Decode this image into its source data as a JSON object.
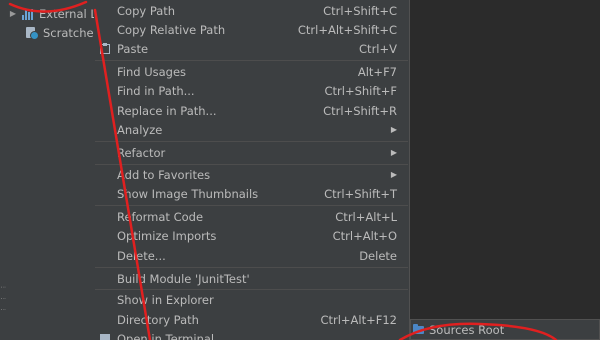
{
  "project_tree": {
    "items": [
      {
        "label": "External L",
        "icon": "library-bars-icon"
      },
      {
        "label": "Scratches",
        "icon": "scratches-icon"
      }
    ]
  },
  "context_menu": {
    "items": [
      {
        "label": "Copy Path",
        "shortcut": "Ctrl+Shift+C"
      },
      {
        "label": "Copy Relative Path",
        "shortcut": "Ctrl+Alt+Shift+C"
      },
      {
        "label": "Paste",
        "shortcut": "Ctrl+V",
        "icon": "paste-icon"
      },
      {
        "label": "Find Usages",
        "shortcut": "Alt+F7"
      },
      {
        "label": "Find in Path...",
        "shortcut": "Ctrl+Shift+F"
      },
      {
        "label": "Replace in Path...",
        "shortcut": "Ctrl+Shift+R"
      },
      {
        "label": "Analyze",
        "shortcut": "",
        "submenu": true
      },
      {
        "label": "Refactor",
        "shortcut": "",
        "submenu": true
      },
      {
        "label": "Add to Favorites",
        "shortcut": "",
        "submenu": true
      },
      {
        "label": "Show Image Thumbnails",
        "shortcut": "Ctrl+Shift+T"
      },
      {
        "label": "Reformat Code",
        "shortcut": "Ctrl+Alt+L"
      },
      {
        "label": "Optimize Imports",
        "shortcut": "Ctrl+Alt+O"
      },
      {
        "label": "Delete...",
        "shortcut": "Delete"
      },
      {
        "label": "Build Module 'JunitTest'",
        "shortcut": ""
      },
      {
        "label": "Show in Explorer",
        "shortcut": ""
      },
      {
        "label": "Directory Path",
        "shortcut": "Ctrl+Alt+F12"
      },
      {
        "label": "Open in Terminal",
        "shortcut": "",
        "icon": "terminal-icon"
      }
    ],
    "submenu_glyph": "▶"
  },
  "submenu": {
    "items": [
      {
        "label": "Sources Root",
        "icon": "sources-root-folder-icon"
      }
    ]
  },
  "colors": {
    "background": "#2b2b2b",
    "panel": "#3c3f41",
    "text": "#bbbbbb",
    "annotation": "#e02020"
  }
}
